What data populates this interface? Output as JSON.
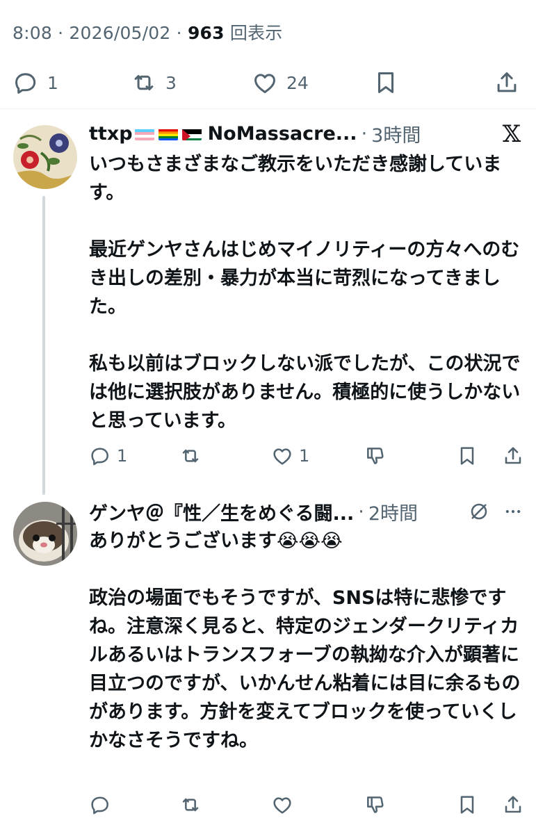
{
  "main_tweet": {
    "time": "8:08",
    "date": "2026/05/02",
    "views_count": "963",
    "views_label": "回表示",
    "replies": "1",
    "retweets": "3",
    "likes": "24"
  },
  "replies": [
    {
      "name": "ttxp",
      "name_suffix": "NoMassacre...",
      "time": "3時間",
      "text": "いつもさまざまなご教示をいただき感謝していま す。\n\n最近ゲンヤさんはじめマイノリティーの方々へのむき出しの差別・暴力が本当に苛烈になってきました。\n\n私も以前はブロックしない派でしたが、この状況では他に選択肢がありません。積極的に使うしかないと思っています。",
      "reply_count": "1",
      "like_count": "1",
      "flags": [
        "transgender-flag",
        "rainbow-flag",
        "palestine-flag"
      ],
      "x_logo": "𝕏"
    },
    {
      "name": "ゲンヤ＠『性／生をめぐる闘...",
      "time": "2時間",
      "text": "ありがとうございます😭😭😭\n\n政治の場面でもそうですが、SNSは特に悲惨ですね。注意深く見ると、特定のジェンダークリティカルあるいはトランスフォーブの執拗な介入が顕著に目立つのですが、いかんせん粘着には目に余るものがあります。方針を変えてブロックを使っていくしかなさそうですね。"
    }
  ],
  "colors": {
    "text_primary": "#0f1419",
    "text_secondary": "#536471",
    "divider": "#eff3f4",
    "thread_line": "#cfd9de"
  }
}
